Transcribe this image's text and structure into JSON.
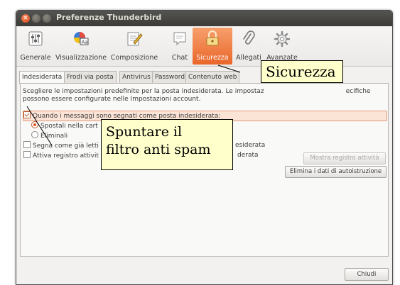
{
  "window": {
    "title": "Preferenze Thunderbird"
  },
  "toolbar": {
    "items": [
      {
        "label": "Generale",
        "icon": "switches-icon"
      },
      {
        "label": "Visualizzazione",
        "icon": "fonts-icon"
      },
      {
        "label": "Composizione",
        "icon": "pencil-paper-icon"
      },
      {
        "label": "Chat",
        "icon": "speech-bubble-icon"
      },
      {
        "label": "Sicurezza",
        "icon": "padlock-icon",
        "selected": true
      },
      {
        "label": "Allegati",
        "icon": "paperclip-icon"
      },
      {
        "label": "Avanzate",
        "icon": "gear-icon"
      }
    ]
  },
  "tabs": [
    {
      "label": "Indesiderata",
      "selected": true
    },
    {
      "label": "Frodi via posta"
    },
    {
      "label": "Antivirus"
    },
    {
      "label": "Password"
    },
    {
      "label": "Contenuto web"
    }
  ],
  "junk": {
    "description": "Scegliere le impostazioni predefinite per la posta indesiderata. Le impostaz",
    "description_tail": "ecifiche",
    "description_line2": "possono essere configurate nelle Impostazioni account.",
    "when_marked": {
      "label": "Quando i messaggi sono segnati come posta indesiderata:",
      "checked": true
    },
    "move_option": {
      "label": "Spostali nella cart",
      "selected": true
    },
    "delete_option": {
      "label": "Eliminali",
      "selected": false
    },
    "mark_read": {
      "label": "Segna come già letti",
      "tail": "esiderata",
      "checked": false
    },
    "activity_log": {
      "label": "Attiva registro attivit",
      "tail": "derata",
      "checked": false
    },
    "show_log_button": "Mostra registro attività",
    "reset_training_button": "Elimina i dati di autoistruzione"
  },
  "footer": {
    "close_button": "Chiudi"
  },
  "callouts": {
    "security": "Sicurezza",
    "spam_line1": "Spuntare il",
    "spam_line2": "filtro anti spam"
  },
  "colors": {
    "accent": "#e9662a",
    "highlight_bg": "#fbe3d6",
    "callout_bg": "#ffffcc",
    "titlebar": "#3c3b37"
  }
}
